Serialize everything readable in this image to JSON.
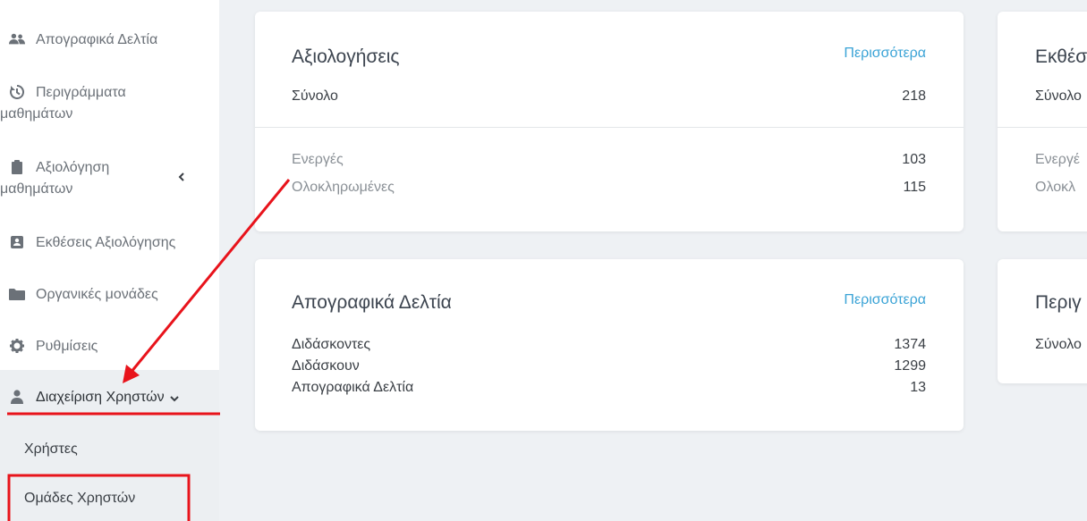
{
  "sidebar": {
    "items": [
      {
        "label": "Απογραφικά Δελτία",
        "icon": "users-icon"
      },
      {
        "label_line1": "Περιγράμματα",
        "label_line2": "μαθημάτων",
        "icon": "history-icon"
      },
      {
        "label_line1": "Αξιολόγηση",
        "label_line2": "μαθημάτων",
        "icon": "clipboard-icon",
        "chevron": "chevron-left-icon"
      },
      {
        "label": "Εκθέσεις Αξιολόγησης",
        "icon": "id-card-icon"
      },
      {
        "label": "Οργανικές μονάδες",
        "icon": "folder-icon"
      },
      {
        "label": "Ρυθμίσεις",
        "icon": "gear-icon"
      },
      {
        "label": "Διαχείριση Χρηστών",
        "icon": "user-icon",
        "chevron": "chevron-down-icon"
      }
    ],
    "submenu": [
      {
        "label": "Χρήστες"
      },
      {
        "label": "Ομάδες Χρηστών"
      }
    ]
  },
  "cards": {
    "evaluations": {
      "title": "Αξιολογήσεις",
      "more": "Περισσότερα",
      "total_label": "Σύνολο",
      "total_value": "218",
      "rows": [
        {
          "label": "Ενεργές",
          "value": "103"
        },
        {
          "label": "Ολοκληρωμένες",
          "value": "115"
        }
      ]
    },
    "reports_partial": {
      "title": "Εκθέσ",
      "total_label": "Σύνολο",
      "rows": [
        {
          "label": "Ενεργέ"
        },
        {
          "label": "Ολοκλ"
        }
      ]
    },
    "census": {
      "title": "Απογραφικά Δελτία",
      "more": "Περισσότερα",
      "rows": [
        {
          "label": "Διδάσκοντες",
          "value": "1374"
        },
        {
          "label": "Διδάσκουν",
          "value": "1299"
        },
        {
          "label": "Απογραφικά Δελτία",
          "value": "13"
        }
      ]
    },
    "outlines_partial": {
      "title": "Περιγ",
      "total_label": "Σύνολο"
    }
  },
  "colors": {
    "annotation_red": "#e8131b",
    "link_blue": "#3aa3d6"
  }
}
